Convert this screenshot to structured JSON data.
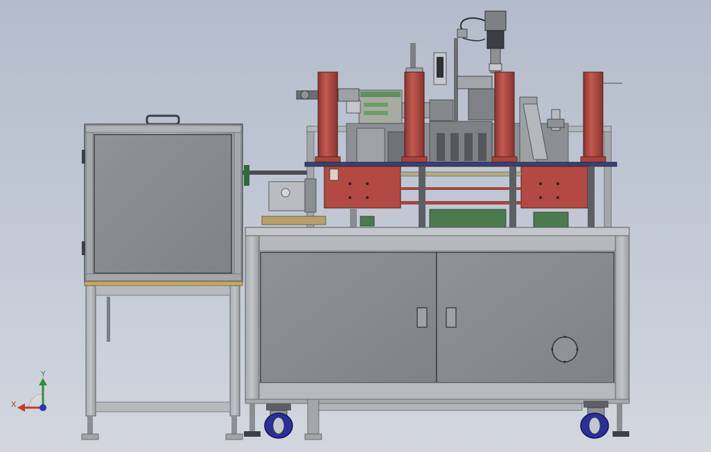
{
  "viewport": {
    "background_top": "#b4bccb",
    "background_bottom": "#d2d7df"
  },
  "model": {
    "frame_color": "#9ea3a8",
    "panel_color": "#8d9094",
    "column_color": "#b24a43",
    "plate_color": "#3a4170",
    "caster_color": "#2b2f9c",
    "motor_color": "#3a3f45",
    "base_green": "#4a7a4e"
  },
  "triad": {
    "x_label": "X",
    "y_label": "Y",
    "x_color": "#c43b2f",
    "y_color": "#2f8f3a",
    "z_color": "#2b34b3"
  }
}
